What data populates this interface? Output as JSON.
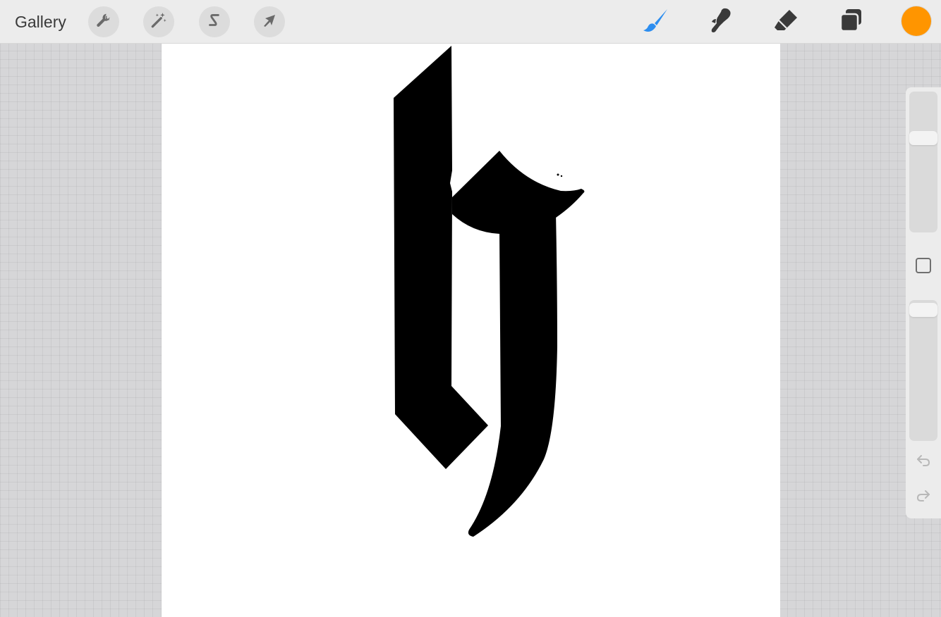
{
  "toolbar": {
    "gallery_label": "Gallery",
    "left_tools": [
      {
        "name": "actions",
        "icon": "wrench-icon"
      },
      {
        "name": "adjustments",
        "icon": "magic-wand-icon"
      },
      {
        "name": "selection",
        "icon": "selection-s-icon"
      },
      {
        "name": "transform",
        "icon": "cursor-arrow-icon"
      }
    ],
    "right_tools": [
      {
        "name": "paint",
        "icon": "brush-icon",
        "active": true
      },
      {
        "name": "smudge",
        "icon": "smudge-finger-icon",
        "active": false
      },
      {
        "name": "erase",
        "icon": "eraser-icon",
        "active": false
      },
      {
        "name": "layers",
        "icon": "layers-icon",
        "active": false
      }
    ],
    "current_color": "#ff9500",
    "active_tool_color": "#2d8ef0"
  },
  "sidebar": {
    "brush_size": 0.7,
    "opacity": 1.0,
    "modify_icon": "square-icon",
    "undo_icon": "undo-arrow-icon",
    "redo_icon": "redo-arrow-icon"
  },
  "canvas": {
    "background": "#ffffff",
    "ink_color": "#000000"
  }
}
